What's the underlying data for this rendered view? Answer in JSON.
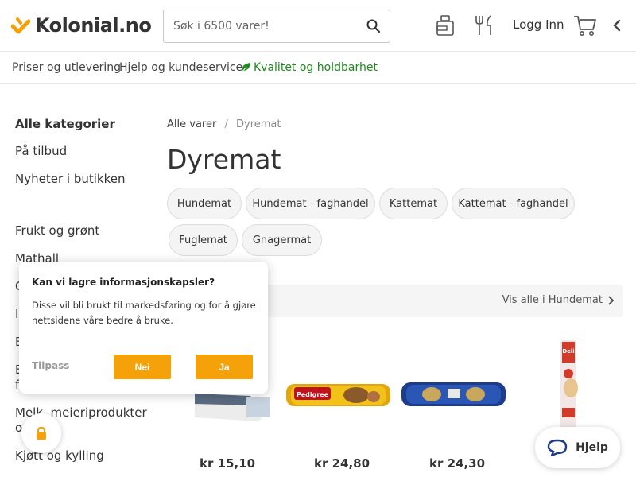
{
  "colors": {
    "brand_orange": "#f5a20a",
    "quality_green": "#1a8c1a",
    "chip_bg": "#f4f4f4"
  },
  "header": {
    "logo_text": "Kolonial.no",
    "search_placeholder": "Søk i 6500 varer!",
    "icons": [
      "recipes-jar-icon",
      "cutlery-icon",
      "cart-icon",
      "chevron-left-icon"
    ],
    "login_label": "Logg Inn"
  },
  "subnav": {
    "prices": "Priser og utlevering",
    "help": "Hjelp og kundeservice",
    "quality": "Kvalitet og holdbarhet"
  },
  "sidebar": {
    "items": [
      "Alle kategorier",
      "På tilbud",
      "Nyheter i butikken",
      "Frukt og grønt",
      "Mathall",
      "C",
      "I",
      "B",
      "B",
      "f",
      "Melk, meieriprodukter",
      "og",
      "Kjøtt og kylling"
    ]
  },
  "breadcrumb": {
    "root": "Alle varer",
    "separator": "/",
    "current": "Dyremat"
  },
  "page_title": "Dyremat",
  "chips": [
    "Hundemat",
    "Hundemat - faghandel",
    "Kattemat",
    "Kattemat - faghandel",
    "Fuglemat",
    "Gnagermat"
  ],
  "section": {
    "view_all": "Vis alle i Hundemat"
  },
  "products": [
    {
      "name": "product-1",
      "price": "kr 15,10"
    },
    {
      "name": "product-pedigree",
      "brand_label": "Pedigree",
      "price": "kr 24,80"
    },
    {
      "name": "product-blue-sausage",
      "price": "kr 24,30"
    },
    {
      "name": "product-stick",
      "brand_label": "Deli",
      "price": ""
    }
  ],
  "cookie": {
    "question": "Kan vi lagre informasjonskapsler?",
    "description": "Disse vil bli brukt til markedsføring og for å gjøre nettsidene våre bedre å bruke.",
    "customize": "Tilpass",
    "no": "Nei",
    "yes": "Ja"
  },
  "help_button": "Hjelp"
}
